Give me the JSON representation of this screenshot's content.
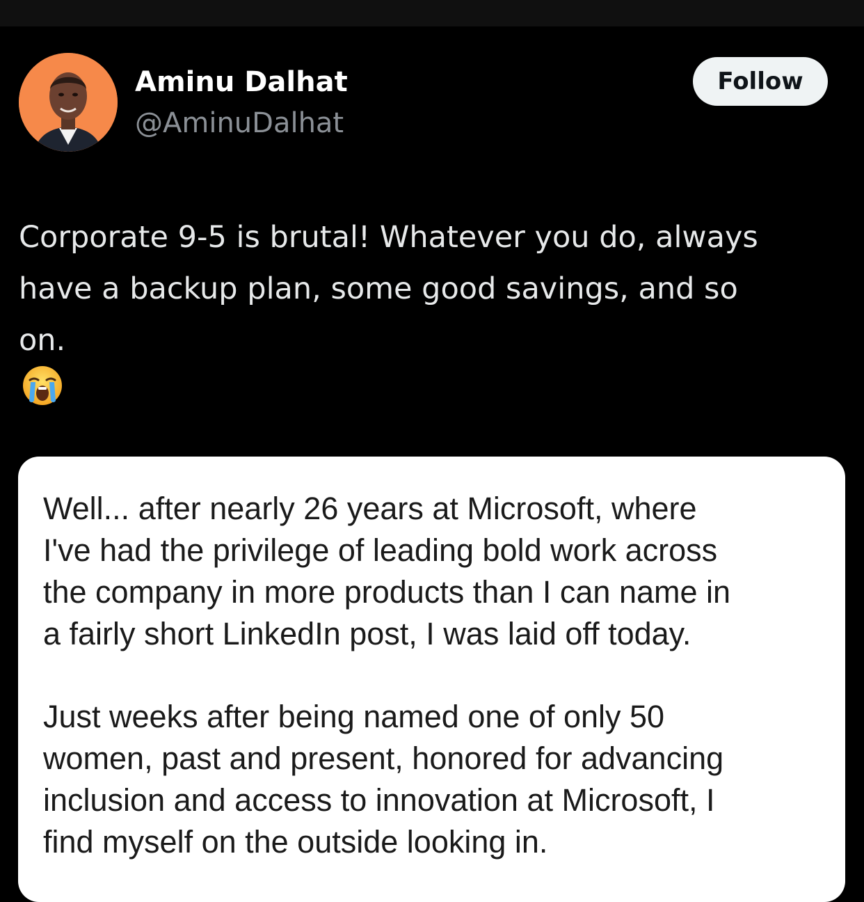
{
  "tweet": {
    "author": {
      "display_name": "Aminu Dalhat",
      "handle": "@AminuDalhat",
      "avatar_bg": "#f6894a"
    },
    "follow_label": "Follow",
    "text_lines": [
      "Corporate 9-5 is brutal! Whatever you do, always",
      "have a backup plan, some good savings, and so",
      "on."
    ],
    "emoji": "loudly-crying-face-icon"
  },
  "card": {
    "paragraph_1_lines": [
      "Well... after nearly 26 years at Microsoft, where",
      "I've had the privilege of leading bold work across",
      "the company in more products than I can name in",
      "a fairly short LinkedIn post, I was laid off today."
    ],
    "paragraph_2_lines": [
      "Just weeks after being named one of only 50",
      "women, past and present, honored for advancing",
      "inclusion and access to innovation at Microsoft, I",
      "find myself on the outside looking in."
    ]
  },
  "colors": {
    "background": "#000000",
    "text_primary": "#e7e9ea",
    "text_secondary": "#8b9096",
    "follow_bg": "#eff3f4",
    "card_bg": "#ffffff"
  }
}
